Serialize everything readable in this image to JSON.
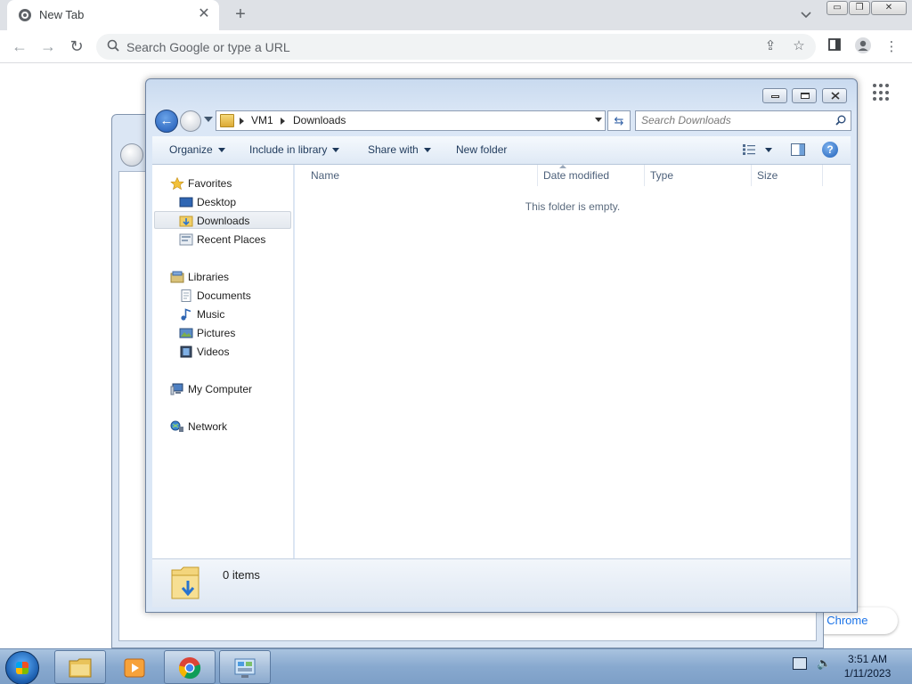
{
  "chrome": {
    "tab_title": "New Tab",
    "tab_close": "✕",
    "new_tab": "+",
    "omnibox_placeholder": "Search Google or type a URL",
    "customize_label": "ize Chrome"
  },
  "explorer": {
    "breadcrumb": [
      "VM1",
      "Downloads"
    ],
    "search_placeholder": "Search Downloads",
    "commands": [
      "Organize",
      "Include in library",
      "Share with",
      "New folder"
    ],
    "nav": {
      "favorites": "Favorites",
      "desktop": "Desktop",
      "downloads": "Downloads",
      "recent": "Recent Places",
      "libraries": "Libraries",
      "documents": "Documents",
      "music": "Music",
      "pictures": "Pictures",
      "videos": "Videos",
      "computer": "My Computer",
      "network": "Network"
    },
    "columns": [
      "Name",
      "Date modified",
      "Type",
      "Size"
    ],
    "empty_message": "This folder is empty.",
    "item_count": "0 items"
  },
  "taskbar": {
    "time": "3:51 AM",
    "date": "1/11/2023"
  },
  "colors": {
    "chrome_tabstrip": "#dee1e6",
    "explorer_frame": "#dbe7f6",
    "taskbar": "#88a9cf"
  }
}
